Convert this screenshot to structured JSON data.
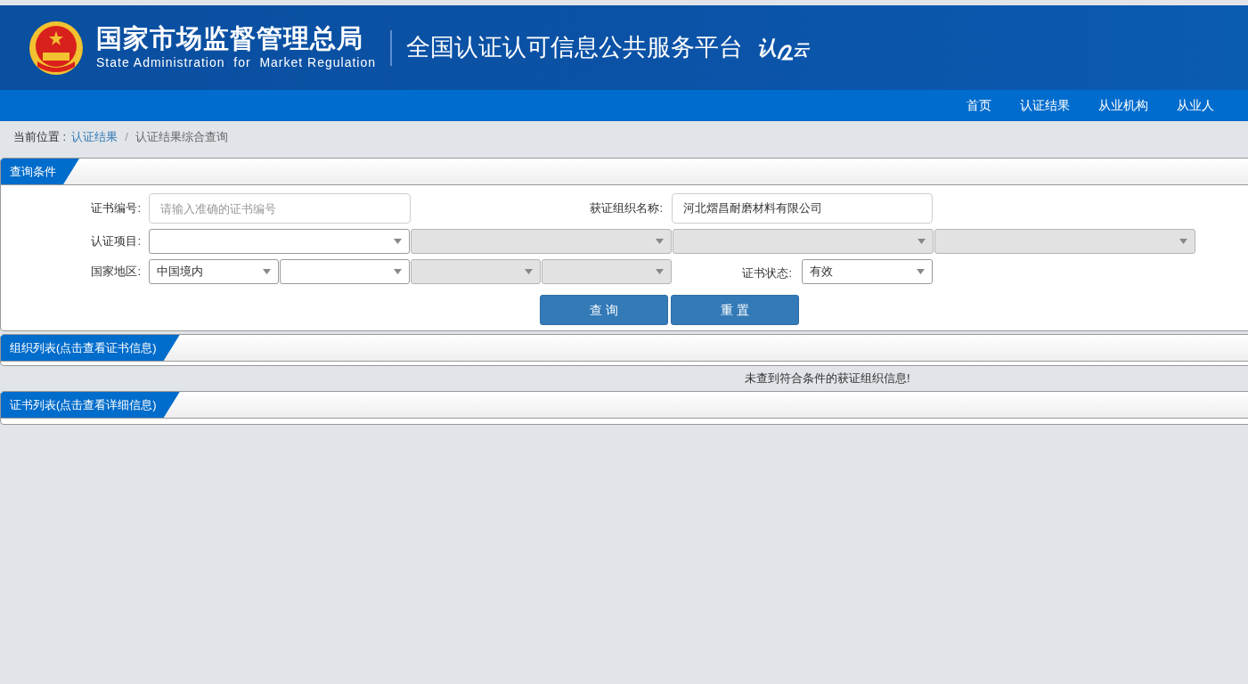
{
  "header": {
    "agency_name": "国家市场监督管理总局",
    "agency_name_en": "State Administration  for  Market Regulation",
    "platform_title": "全国认证认可信息公共服务平台",
    "logo_parts": [
      "认",
      "云"
    ]
  },
  "nav": [
    {
      "label": "首页",
      "selected": false
    },
    {
      "label": "认证结果",
      "selected": false
    },
    {
      "label": "从业机构",
      "selected": false
    },
    {
      "label": "从业人",
      "selected": false
    }
  ],
  "breadcrumb": {
    "prefix": "当前位置 :",
    "separator": "/",
    "items": [
      "认证结果",
      "认证结果综合查询"
    ]
  },
  "query_panel": {
    "title": "查询条件",
    "cert_number": {
      "label": "证书编号:",
      "placeholder": "请输入准确的证书编号"
    },
    "org_name": {
      "label": "获证组织名称:",
      "value": "河北熠昌耐磨材料有限公司"
    },
    "cert_project": {
      "label": "认证项目:",
      "selects": [
        {
          "disabled": false
        },
        {
          "disabled": true
        },
        {
          "disabled": true
        },
        {
          "disabled": true
        }
      ]
    },
    "region": {
      "label": "国家地区:",
      "selects": [
        {
          "value": "中国境内",
          "disabled": false
        },
        {
          "disabled": false
        },
        {
          "disabled": true
        },
        {
          "disabled": true
        }
      ]
    },
    "cert_status": {
      "label": "证书状态:",
      "value": "有效",
      "disabled": false
    },
    "buttons": [
      "查 询",
      "重 置"
    ]
  },
  "org_list": {
    "title": "组织列表(点击查看证书信息)",
    "empty_message": "未查到符合条件的获证组织信息!"
  },
  "cert_list": {
    "title": "证书列表(点击查看详细信息)"
  }
}
